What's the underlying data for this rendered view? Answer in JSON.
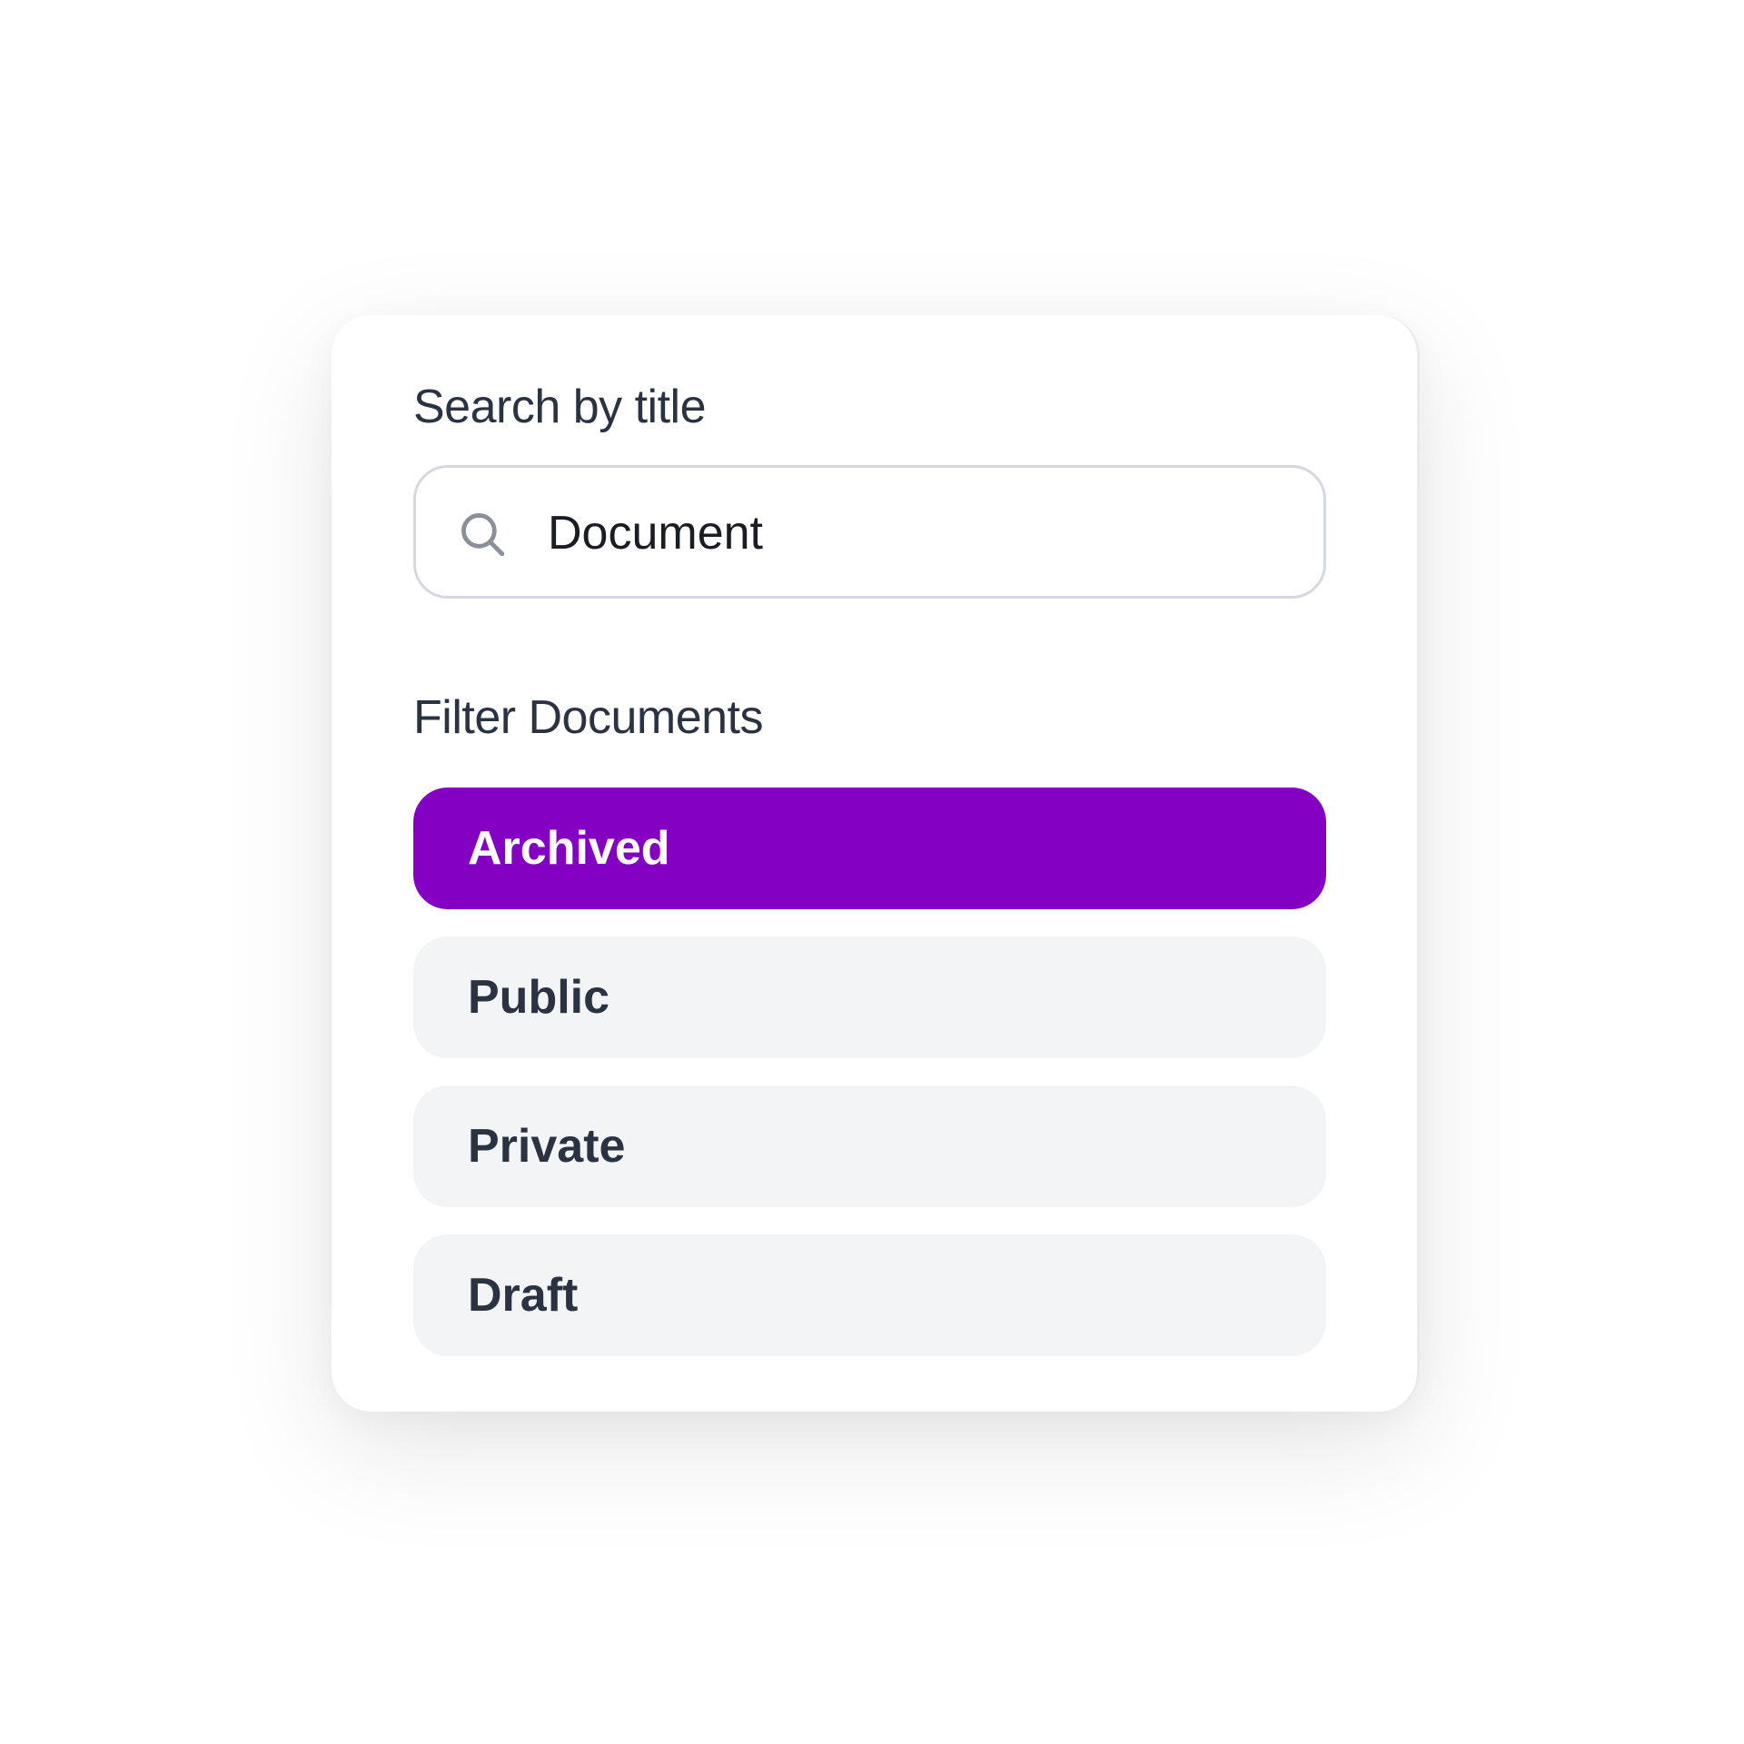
{
  "search": {
    "label": "Search by title",
    "value": "Document",
    "icon": "search-icon"
  },
  "filters": {
    "label": "Filter Documents",
    "items": [
      {
        "label": "Archived",
        "active": true
      },
      {
        "label": "Public",
        "active": false
      },
      {
        "label": "Private",
        "active": false
      },
      {
        "label": "Draft",
        "active": false
      }
    ]
  },
  "colors": {
    "accent": "#8400c2",
    "item_bg": "#f3f4f6",
    "text": "#2b3342"
  }
}
